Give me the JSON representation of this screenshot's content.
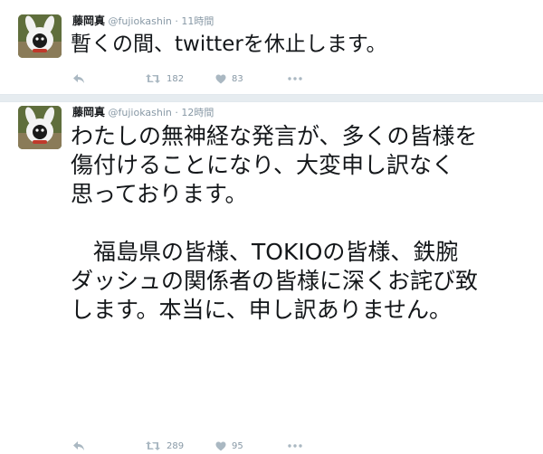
{
  "tweets": [
    {
      "name": "藤岡真",
      "handle": "@fujiokashin",
      "separator": "·",
      "time": "11時間",
      "text": "暫くの間、twitterを休止します。",
      "retweets": "182",
      "likes": "83"
    },
    {
      "name": "藤岡真",
      "handle": "@fujiokashin",
      "separator": "·",
      "time": "12時間",
      "text": "わたしの無神経な発言が、多くの皆様を\n傷付けることになり、大変申し訳なく\n思っております。\n\n　福島県の皆様、TOKIOの皆様、鉄腕\nダッシュの関係者の皆様に深くお詫び致\nします。本当に、申し訳ありません。",
      "retweets": "289",
      "likes": "95"
    }
  ],
  "icons": {
    "reply": "reply-icon",
    "retweet": "retweet-icon",
    "like": "heart-icon",
    "more": "more-icon"
  },
  "colors": {
    "text": "#14171a",
    "meta": "#8899a6",
    "action_icon": "#aab8c2",
    "separator": "#e6ecf0"
  }
}
